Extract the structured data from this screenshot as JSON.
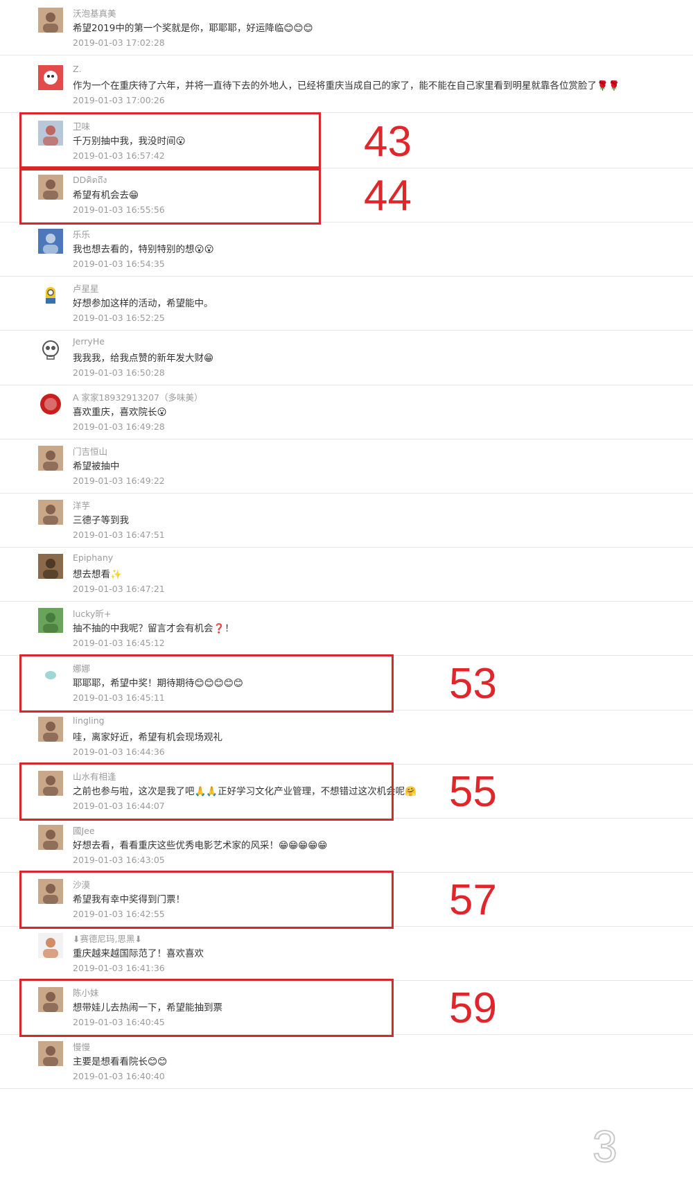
{
  "comments": [
    {
      "name": "沃泡基真美",
      "text": "希望2019中的第一个奖就是你，耶耶耶，好运降临😊😊😊",
      "time": "2019-01-03 17:02:28",
      "avatar": "person-avatar"
    },
    {
      "name": "Z.",
      "text": "作为一个在重庆待了六年，并将一直待下去的外地人，已经将重庆当成自己的家了，能不能在自己家里看到明星就靠各位赏脸了🌹🌹",
      "time": "2019-01-03 17:00:26",
      "avatar": "red-cartoon-avatar"
    },
    {
      "name": "卫味",
      "text": "千万别抽中我，我没时间😮",
      "time": "2019-01-03 16:57:42",
      "avatar": "landscape-avatar"
    },
    {
      "name": "DDคิดถึง",
      "text": "希望有机会去😁",
      "time": "2019-01-03 16:55:56",
      "avatar": "person-avatar"
    },
    {
      "name": "乐乐",
      "text": "我也想去看的，特别特别的想😮😮",
      "time": "2019-01-03 16:54:35",
      "avatar": "sky-avatar"
    },
    {
      "name": "卢星星",
      "text": "好想参加这样的活动，希望能中。",
      "time": "2019-01-03 16:52:25",
      "avatar": "minion-avatar"
    },
    {
      "name": "JerryHe",
      "text": "我我我，给我点赞的新年发大财😁",
      "time": "2019-01-03 16:50:28",
      "avatar": "skull-avatar"
    },
    {
      "name": "A 家家18932913207（多味美）",
      "text": "喜欢重庆，喜欢院长😮",
      "time": "2019-01-03 16:49:28",
      "avatar": "brand-avatar"
    },
    {
      "name": "门吉恒山",
      "text": "希望被抽中",
      "time": "2019-01-03 16:49:22",
      "avatar": "person-avatar"
    },
    {
      "name": "洋芋",
      "text": "三德子等到我",
      "time": "2019-01-03 16:47:51",
      "avatar": "person-avatar"
    },
    {
      "name": "Epiphany",
      "text": "想去想看✨",
      "time": "2019-01-03 16:47:21",
      "avatar": "cat-avatar"
    },
    {
      "name": "lucky昕+",
      "text": "抽不抽的中我呢？留言才会有机会❓！",
      "time": "2019-01-03 16:45:12",
      "avatar": "grass-avatar"
    },
    {
      "name": "娜娜",
      "text": "耶耶耶，希望中奖！期待期待😊😊😊😊😊",
      "time": "2019-01-03 16:45:11",
      "avatar": "default-avatar"
    },
    {
      "name": "lingling",
      "text": "哇，离家好近，希望有机会现场观礼",
      "time": "2019-01-03 16:44:36",
      "avatar": "person-avatar"
    },
    {
      "name": "山水有相逢",
      "text": "之前也参与啦，这次是我了吧🙏🙏正好学习文化产业管理，不想错过这次机会呢🤗",
      "time": "2019-01-03 16:44:07",
      "avatar": "person-avatar"
    },
    {
      "name": "國Jee",
      "text": "好想去看，看看重庆这些优秀电影艺术家的风采！😁😁😁😁😁",
      "time": "2019-01-03 16:43:05",
      "avatar": "person-avatar"
    },
    {
      "name": "沙漠",
      "text": "希望我有幸中奖得到门票！",
      "time": "2019-01-03 16:42:55",
      "avatar": "person-avatar"
    },
    {
      "name": "⬇赛德尼玛,思黑⬇",
      "text": "重庆越来越国际范了！喜欢喜欢",
      "time": "2019-01-03 16:41:36",
      "avatar": "runner-avatar"
    },
    {
      "name": "陈小妹",
      "text": "想带娃儿去热闹一下，希望能抽到票",
      "time": "2019-01-03 16:40:45",
      "avatar": "person-avatar"
    },
    {
      "name": "慢慢",
      "text": "主要是想看看院长😊😊",
      "time": "2019-01-03 16:40:40",
      "avatar": "person-avatar"
    }
  ],
  "highlights": [
    {
      "index": 2,
      "number": "43"
    },
    {
      "index": 3,
      "number": "44"
    },
    {
      "index": 12,
      "number": "53"
    },
    {
      "index": 14,
      "number": "55"
    },
    {
      "index": 16,
      "number": "57"
    },
    {
      "index": 18,
      "number": "59"
    }
  ],
  "page_number": "3",
  "colors": {
    "highlight": "#d9262a",
    "name": "#9b9b9b",
    "text": "#333333",
    "divider": "#e6e6e6"
  }
}
